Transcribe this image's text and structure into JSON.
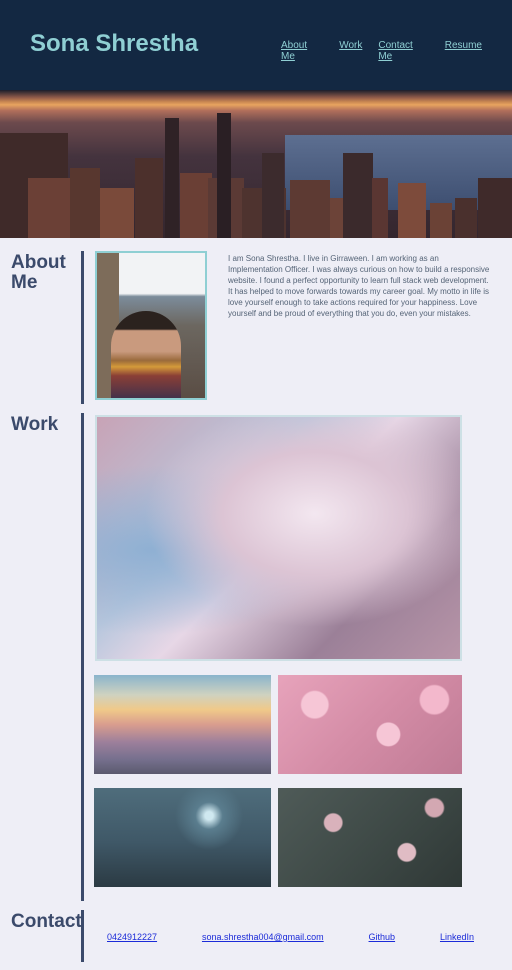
{
  "header": {
    "brand": "Sona Shrestha",
    "nav": [
      "About Me",
      "Work",
      "Contact Me",
      "Resume"
    ]
  },
  "about": {
    "title": "About Me",
    "bio": "I am Sona Shrestha. I live in Girraween. I am working as an Implementation Officer. I was always curious on how to build a responsive website. I found a perfect opportunity to learn full stack web development. It has helped to move forwards towards my career goal. My motto in life is love yourself enough to take actions required for your happiness. Love yourself and be proud of everything that you do, even your mistakes."
  },
  "work": {
    "title": "Work"
  },
  "contact": {
    "title": "Contact",
    "phone": "0424912227",
    "email": "sona.shrestha004@gmail.com",
    "github": "Github",
    "linkedin": "LinkedIn"
  },
  "colors": {
    "header_bg": "#132842",
    "accent": "#8fcfd3",
    "heading": "#3b4a6b",
    "link": "#1b2bd8",
    "page_bg": "#eeeef6"
  }
}
